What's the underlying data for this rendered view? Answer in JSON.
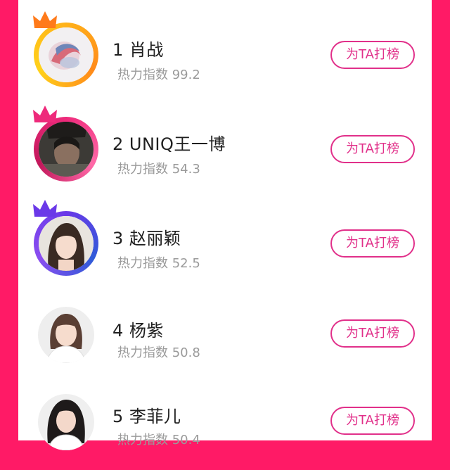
{
  "ranking": [
    {
      "rank_name": "1 肖战",
      "heat_label": "热力指数",
      "heat_value": "99.2",
      "action": "为TA打榜",
      "crown_color": "#ff7a1a",
      "ring": "gold"
    },
    {
      "rank_name": "2 UNIQ王一博",
      "heat_label": "热力指数",
      "heat_value": "54.3",
      "action": "为TA打榜",
      "crown_color": "#ee2a7b",
      "ring": "pink"
    },
    {
      "rank_name": "3 赵丽颖",
      "heat_label": "热力指数",
      "heat_value": "52.5",
      "action": "为TA打榜",
      "crown_color": "#6a38e8",
      "ring": "purple"
    },
    {
      "rank_name": "4 杨紫",
      "heat_label": "热力指数",
      "heat_value": "50.8",
      "action": "为TA打榜"
    },
    {
      "rank_name": "5 李菲儿",
      "heat_label": "热力指数",
      "heat_value": "50.4",
      "action": "为TA打榜"
    }
  ],
  "colors": {
    "background": "#ff1a66",
    "button": "#e1308a",
    "heat_text": "#9a9a9a"
  }
}
